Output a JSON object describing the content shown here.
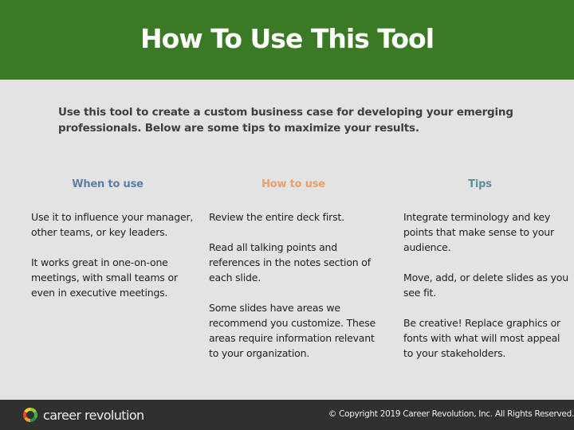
{
  "header": {
    "title": "How To Use This Tool",
    "background_color": "#3a7a24"
  },
  "intro": {
    "text": "Use this tool to create a custom business case for developing your emerging professionals. Below are some tips to maximize your results."
  },
  "columns": [
    {
      "heading": "When to use",
      "heading_color": "#5b7fa8",
      "items": [
        "Use it to influence your manager, other teams, or key leaders.",
        "It works great in one-on-one meetings, with small teams or even in executive meetings."
      ]
    },
    {
      "heading": "How to use",
      "heading_color": "#e9a06a",
      "items": [
        "Review the entire deck first.",
        "Read all talking points and references in the notes section of each slide.",
        "Some slides have areas we recommend you customize. These areas require information relevant to your organization."
      ]
    },
    {
      "heading": "Tips",
      "heading_color": "#5e8f9e",
      "items": [
        "Integrate terminology and key points that make sense to your audience.",
        "Move, add, or delete slides as you see fit.",
        "Be creative! Replace graphics or fonts with what will most appeal to your stakeholders."
      ]
    }
  ],
  "footer": {
    "logo_icon": "career-revolution-logo-icon",
    "logo_text": "career revolution",
    "copyright": "© Copyright 2019 Career Revolution, Inc. All Rights Reserved."
  }
}
